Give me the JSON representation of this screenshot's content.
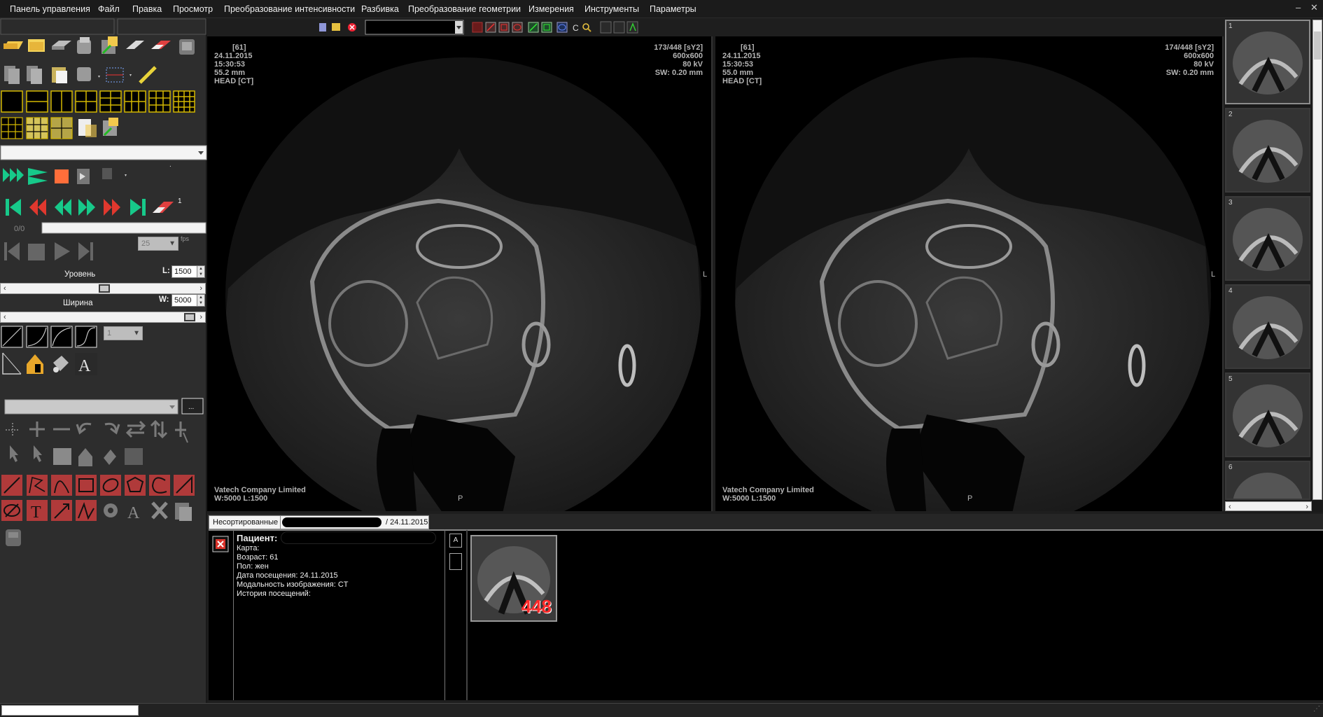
{
  "menu": [
    "Панель управления",
    "Файл",
    "Правка",
    "Просмотр",
    "Преобразование интенсивности",
    "Разбивка",
    "Преобразование геометрии",
    "Измерения",
    "Инструменты",
    "Параметры"
  ],
  "window_controls": [
    "‒",
    "✕"
  ],
  "left_panel": {
    "frame_counter": "0/0",
    "speed_value": "25",
    "speed_unit": "fps",
    "page_count": "1",
    "level": {
      "label": "Уровень",
      "prefix": "L:",
      "value": "1500"
    },
    "width": {
      "label": "Ширина",
      "prefix": "W:",
      "value": "5000"
    },
    "curve_combo_value": "1",
    "browse_button_label": "..."
  },
  "viewers": [
    {
      "top_left": [
        "[61]",
        "24.11.2015",
        "15:30:53",
        "55.2 mm",
        "HEAD [CT]"
      ],
      "top_right": [
        "173/448 [sY2]",
        "600x600",
        "80 kV",
        "SW: 0.20 mm"
      ],
      "bottom_left": [
        "Vatech Company Limited",
        "W:5000 L:1500"
      ],
      "orient_right": "L",
      "orient_bottom": "P"
    },
    {
      "top_left": [
        "[61]",
        "24.11.2015",
        "15:30:53",
        "55.0 mm",
        "HEAD [CT]"
      ],
      "top_right": [
        "174/448 [sY2]",
        "600x600",
        "80 kV",
        "SW: 0.20 mm"
      ],
      "bottom_left": [
        "Vatech Company Limited",
        "W:5000 L:1500"
      ],
      "orient_right": "L",
      "orient_bottom": "P"
    }
  ],
  "thumbnails": [
    "1",
    "2",
    "3",
    "4",
    "5",
    "6"
  ],
  "tabs": {
    "unsorted": "Несортированные",
    "date_tab": "/ 24.11.2015"
  },
  "patient": {
    "title": "Пациент:",
    "card": "Карта:",
    "age": "Возраст: 61",
    "sex": "Пол: жен",
    "visit_date": "Дата посещения: 24.11.2015",
    "modality": "Модальность изображения: CT",
    "history": "История посещений:"
  },
  "series": {
    "count": "448",
    "side_a": "A"
  },
  "colors": {
    "accent_green": "#17c98a",
    "accent_red": "#e0382e",
    "icon_yellow": "#e8d33a",
    "count_red": "#ff2a2a"
  }
}
